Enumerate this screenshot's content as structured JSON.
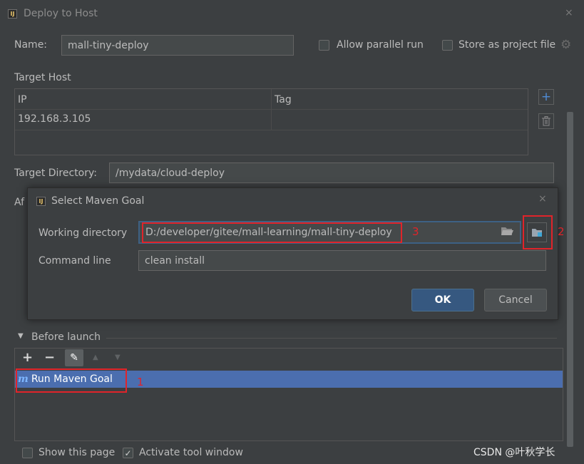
{
  "window": {
    "title": "Deploy to Host",
    "app_icon_glyph": "IJ",
    "close_glyph": "×"
  },
  "name_row": {
    "label": "Name:",
    "value": "mall-tiny-deploy"
  },
  "options": {
    "allow_parallel_run": "Allow parallel run",
    "store_as_project_file": "Store as project file",
    "gear_glyph": "⚙"
  },
  "target_host": {
    "heading": "Target Host",
    "columns": [
      "IP",
      "Tag"
    ],
    "rows": [
      {
        "ip": "192.168.3.105",
        "tag": ""
      }
    ],
    "add_glyph": "+",
    "delete_glyph": "🗑"
  },
  "target_directory": {
    "label": "Target Directory:",
    "value": "/mydata/cloud-deploy"
  },
  "after_label_partial": "Af",
  "maven_dialog": {
    "title": "Select Maven Goal",
    "app_icon_glyph": "IJ",
    "close_glyph": "×",
    "working_directory_label": "Working directory",
    "working_directory_value": "D:/developer/gitee/mall-learning/mall-tiny-deploy",
    "command_line_label": "Command line",
    "command_line_value": "clean install",
    "ok_label": "OK",
    "cancel_label": "Cancel"
  },
  "before_launch": {
    "heading": "Before launch",
    "toolbar": {
      "add": "+",
      "remove": "−",
      "edit": "✎",
      "up": "▲",
      "down": "▼"
    },
    "items": [
      {
        "label": "Run Maven Goal",
        "icon_glyph": "m"
      }
    ]
  },
  "footer": {
    "show_this_page": "Show this page",
    "activate_tool_window": "Activate tool window",
    "check_glyph": "✓"
  },
  "annotations": {
    "n1": "1",
    "n2": "2",
    "n3": "3"
  },
  "watermark": "CSDN @叶秋学长",
  "colors": {
    "accent": "#4b6eaf",
    "annotation_red": "#e0242a",
    "background": "#3c3f41"
  }
}
